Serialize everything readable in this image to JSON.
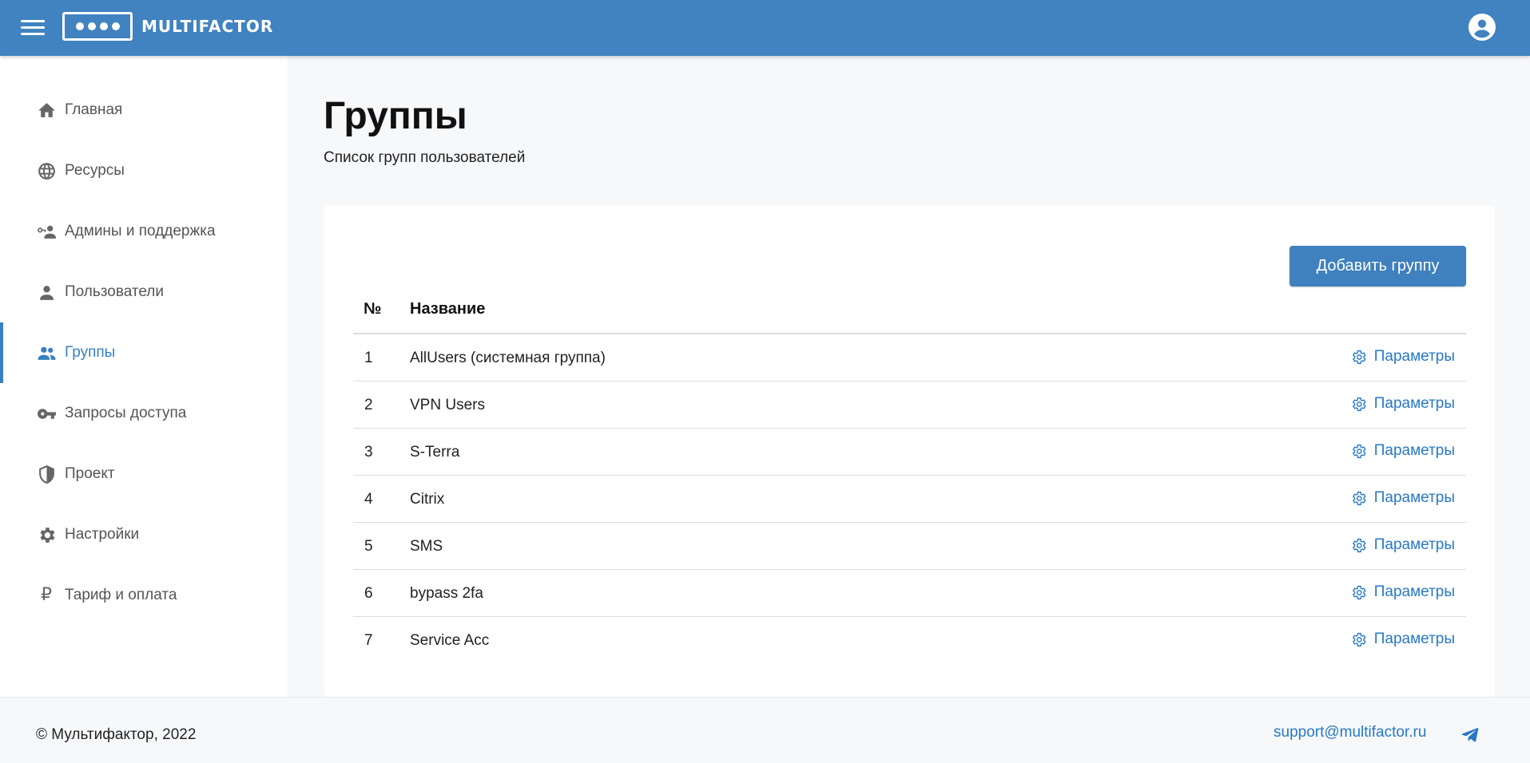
{
  "header": {
    "logo_text": "MULTIFACTOR",
    "brand_color": "#4083c0",
    "menu_icon": "hamburger-icon",
    "account_icon": "account-circle-icon"
  },
  "sidebar": {
    "items": [
      {
        "label": "Главная",
        "icon": "home-icon",
        "active": false
      },
      {
        "label": "Ресурсы",
        "icon": "globe-icon",
        "active": false
      },
      {
        "label": "Админы и поддержка",
        "icon": "admin-key-user-icon",
        "active": false
      },
      {
        "label": "Пользователи",
        "icon": "user-icon",
        "active": false
      },
      {
        "label": "Группы",
        "icon": "users-group-icon",
        "active": true
      },
      {
        "label": "Запросы доступа",
        "icon": "key-icon",
        "active": false
      },
      {
        "label": "Проект",
        "icon": "shield-icon",
        "active": false
      },
      {
        "label": "Настройки",
        "icon": "gear-icon",
        "active": false
      },
      {
        "label": "Тариф и оплата",
        "icon": "ruble-icon",
        "active": false
      }
    ]
  },
  "page": {
    "title": "Группы",
    "subtitle": "Список групп пользователей"
  },
  "table": {
    "add_button_label": "Добавить группу",
    "columns": [
      "№",
      "Название"
    ],
    "action_label": "Параметры",
    "action_icon": "gear-outline-icon",
    "rows": [
      {
        "num": "1",
        "name": "AllUsers (системная группа)"
      },
      {
        "num": "2",
        "name": "VPN Users"
      },
      {
        "num": "3",
        "name": "S-Terra"
      },
      {
        "num": "4",
        "name": "Citrix"
      },
      {
        "num": "5",
        "name": "SMS"
      },
      {
        "num": "6",
        "name": "bypass 2fa"
      },
      {
        "num": "7",
        "name": "Service Acc"
      }
    ]
  },
  "footer": {
    "copyright": "© Мультифактор, 2022",
    "support_email": "support@multifactor.ru",
    "telegram_icon": "telegram-icon"
  }
}
